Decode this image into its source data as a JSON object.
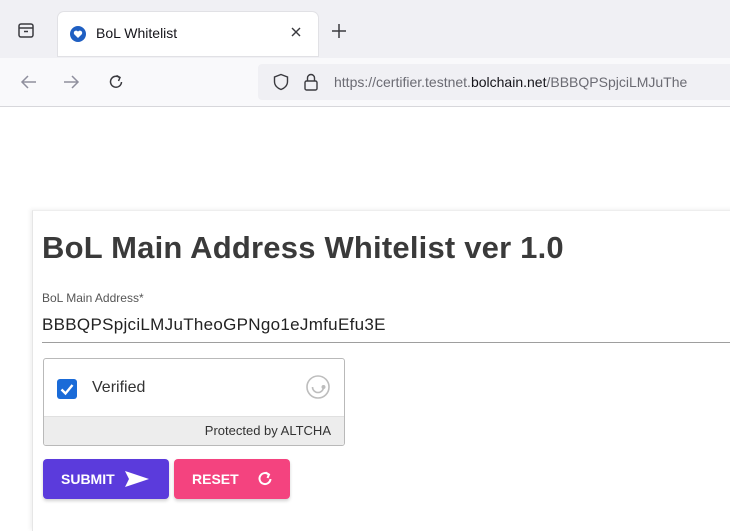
{
  "browser": {
    "tab": {
      "title": "BoL Whitelist",
      "favicon": "bol-heart-icon"
    },
    "address_bar": {
      "url_prefix": "https://certifier.testnet.",
      "url_host": "bolchain.net",
      "url_suffix": "/BBBQPSpjciLMJuThe"
    },
    "icons": [
      "tab-list-icon",
      "close-icon",
      "plus-icon",
      "back-arrow-icon",
      "forward-arrow-icon",
      "reload-icon",
      "shield-icon",
      "lock-icon"
    ]
  },
  "form": {
    "title": "BoL Main Address Whitelist ver 1.0",
    "address_label": "BoL Main Address*",
    "address_value": "BBBQPSpjciLMJuTheoGPNgo1eJmfuEfu3E"
  },
  "altcha": {
    "checked": true,
    "label": "Verified",
    "footer": "Protected by ALTCHA"
  },
  "buttons": {
    "submit_label": "SUBMIT",
    "reset_label": "RESET"
  },
  "colors": {
    "submit": "#5b3bdc",
    "reset": "#f4437f",
    "checkbox": "#1a6bd8"
  }
}
